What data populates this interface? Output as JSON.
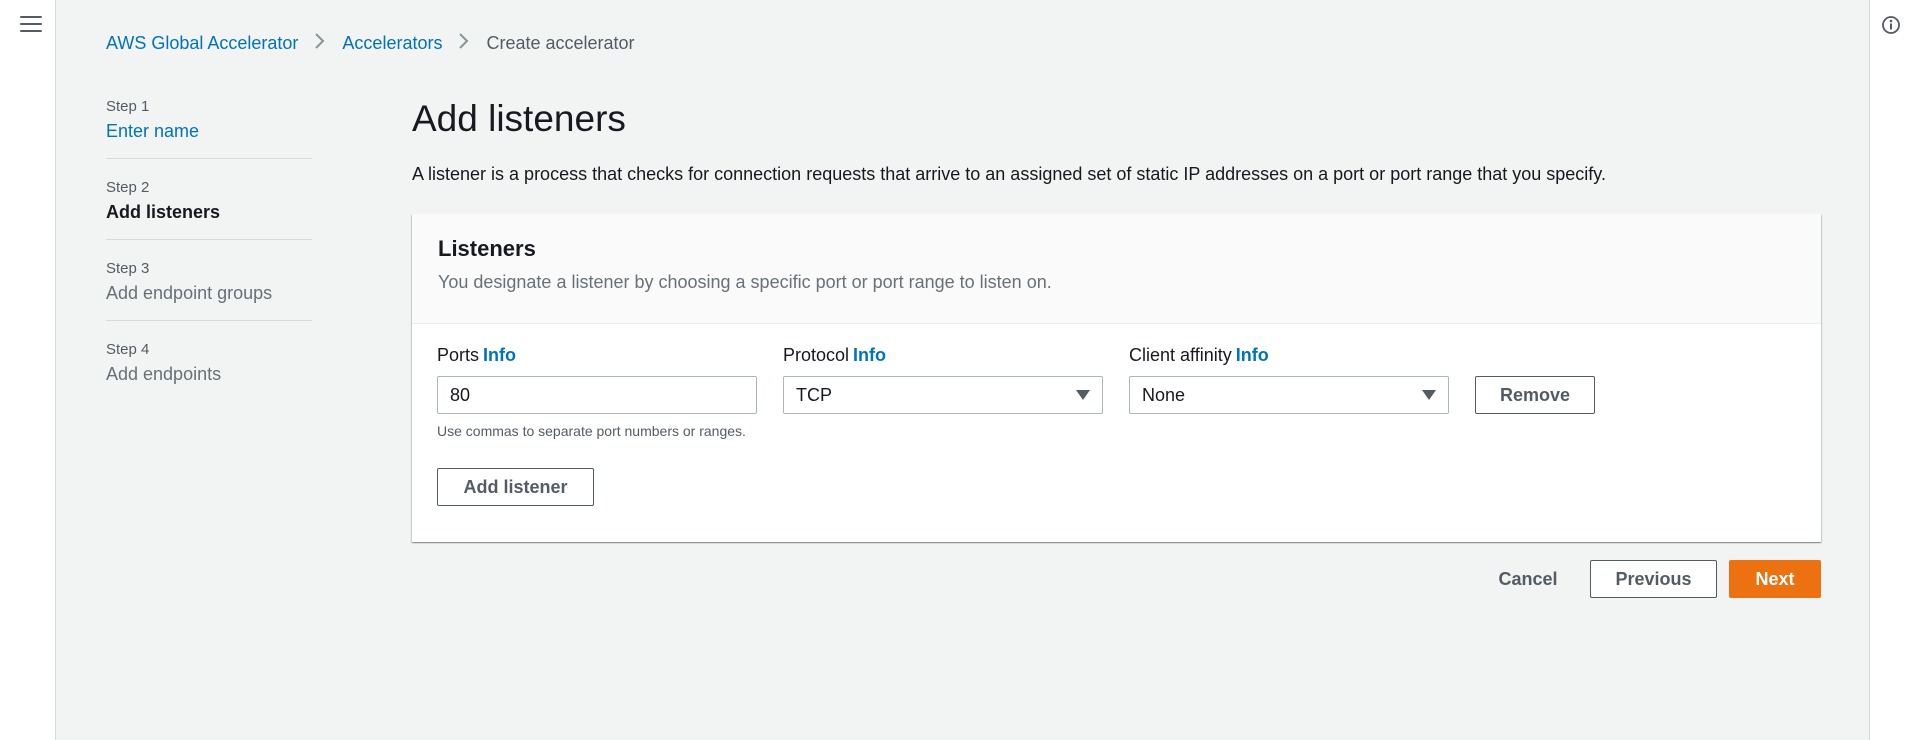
{
  "breadcrumb": {
    "items": [
      "AWS Global Accelerator",
      "Accelerators"
    ],
    "current": "Create accelerator"
  },
  "steps": [
    {
      "number": "Step 1",
      "label": "Enter name"
    },
    {
      "number": "Step 2",
      "label": "Add listeners"
    },
    {
      "number": "Step 3",
      "label": "Add endpoint groups"
    },
    {
      "number": "Step 4",
      "label": "Add endpoints"
    }
  ],
  "page": {
    "title": "Add listeners",
    "description": "A listener is a process that checks for connection requests that arrive to an assigned set of static IP addresses on a port or port range that you specify."
  },
  "listeners": {
    "title": "Listeners",
    "description": "You designate a listener by choosing a specific port or port range to listen on.",
    "info_label": "Info",
    "ports": {
      "label": "Ports",
      "value": "80",
      "hint": "Use commas to separate port numbers or ranges."
    },
    "protocol": {
      "label": "Protocol",
      "value": "TCP"
    },
    "client_affinity": {
      "label": "Client affinity",
      "value": "None"
    },
    "remove_label": "Remove",
    "add_listener_label": "Add listener"
  },
  "footer": {
    "cancel_label": "Cancel",
    "previous_label": "Previous",
    "next_label": "Next"
  },
  "colors": {
    "link": "#0073bb",
    "primary": "#ec7211",
    "background": "#f2f3f3"
  },
  "icons": {
    "menu": "menu-icon",
    "chevron": "chevron-right-icon",
    "info": "info-icon",
    "caret": "caret-down-icon"
  }
}
